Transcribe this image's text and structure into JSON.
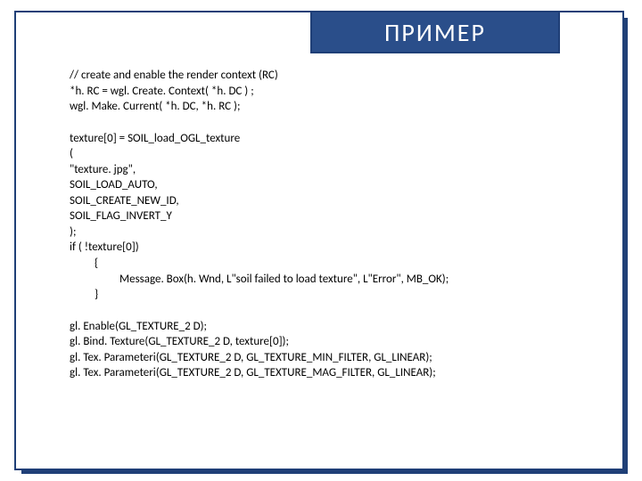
{
  "title": "ПРИМЕР",
  "block1": {
    "l1": "// create and enable the render context (RC)",
    "l2": "*h. RC = wgl. Create. Context( *h. DC ) ;",
    "l3": "wgl. Make. Current( *h. DC, *h. RC );"
  },
  "block2": {
    "l1": "texture[0] = SOIL_load_OGL_texture",
    "l2": "(",
    "l3": "\"texture. jpg\",",
    "l4": "SOIL_LOAD_AUTO,",
    "l5": "SOIL_CREATE_NEW_ID,",
    "l6": "SOIL_FLAG_INVERT_Y",
    "l7": ");",
    "l8": "if ( !texture[0])",
    "l9": "{",
    "l10": "Message. Box(h. Wnd, L\"soil failed to load texture\", L\"Error\", MB_OK);",
    "l11": "}"
  },
  "block3": {
    "l1": "gl. Enable(GL_TEXTURE_2 D);",
    "l2": "gl. Bind. Texture(GL_TEXTURE_2 D, texture[0]);",
    "l3": "gl. Tex. Parameteri(GL_TEXTURE_2 D, GL_TEXTURE_MIN_FILTER, GL_LINEAR);",
    "l4": "gl. Tex. Parameteri(GL_TEXTURE_2 D, GL_TEXTURE_MAG_FILTER, GL_LINEAR);"
  }
}
